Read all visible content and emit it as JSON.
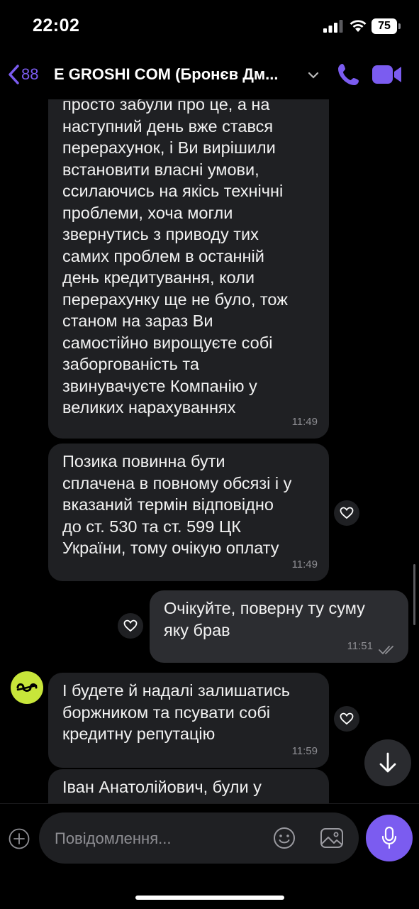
{
  "status_bar": {
    "time": "22:02",
    "battery": "75"
  },
  "header": {
    "back_count": "88",
    "title": "E GROSHI COM (Бронєв Дм..."
  },
  "messages": [
    {
      "direction": "in",
      "text": "просто забули про це, а на\nнаступний день вже стався\nперерахунок, і Ви вирішили\nвстановити власні умови,\nссилаючись на якісь технічні\nпроблеми, хоча могли\nзвернутись з приводу тих\nсамих проблем в останній\nдень кредитування, коли\nперерахунку ще не було, тож\nстаном на зараз Ви\nсамостійно вирощуєте собі\nзаборгованість та\nзвинувачуєте Компанію у\nвеликих нарахуваннях",
      "time": "11:49"
    },
    {
      "direction": "in",
      "text": "Позика повинна бути\nсплачена в повному обсязі і у\nвказаний термін відповідно\nдо ст. 530 та ст. 599 ЦК\nУкраїни, тому очікую оплату",
      "time": "11:49"
    },
    {
      "direction": "out",
      "text": "Очікуйте, поверну ту суму\nяку брав",
      "time": "11:51"
    },
    {
      "direction": "in",
      "text": "І будете й надалі залишатись\nборжником та псувати собі\nкредитну репутацію",
      "time": "11:59"
    },
    {
      "direction": "in",
      "text": "Іван Анатолійович, були у",
      "time": ""
    }
  ],
  "composer": {
    "placeholder": "Повідомлення..."
  },
  "colors": {
    "accent": "#7b5cf0",
    "bubble_in": "#1f2023",
    "bubble_out": "#2c2d31",
    "avatar": "#c8e63a"
  }
}
